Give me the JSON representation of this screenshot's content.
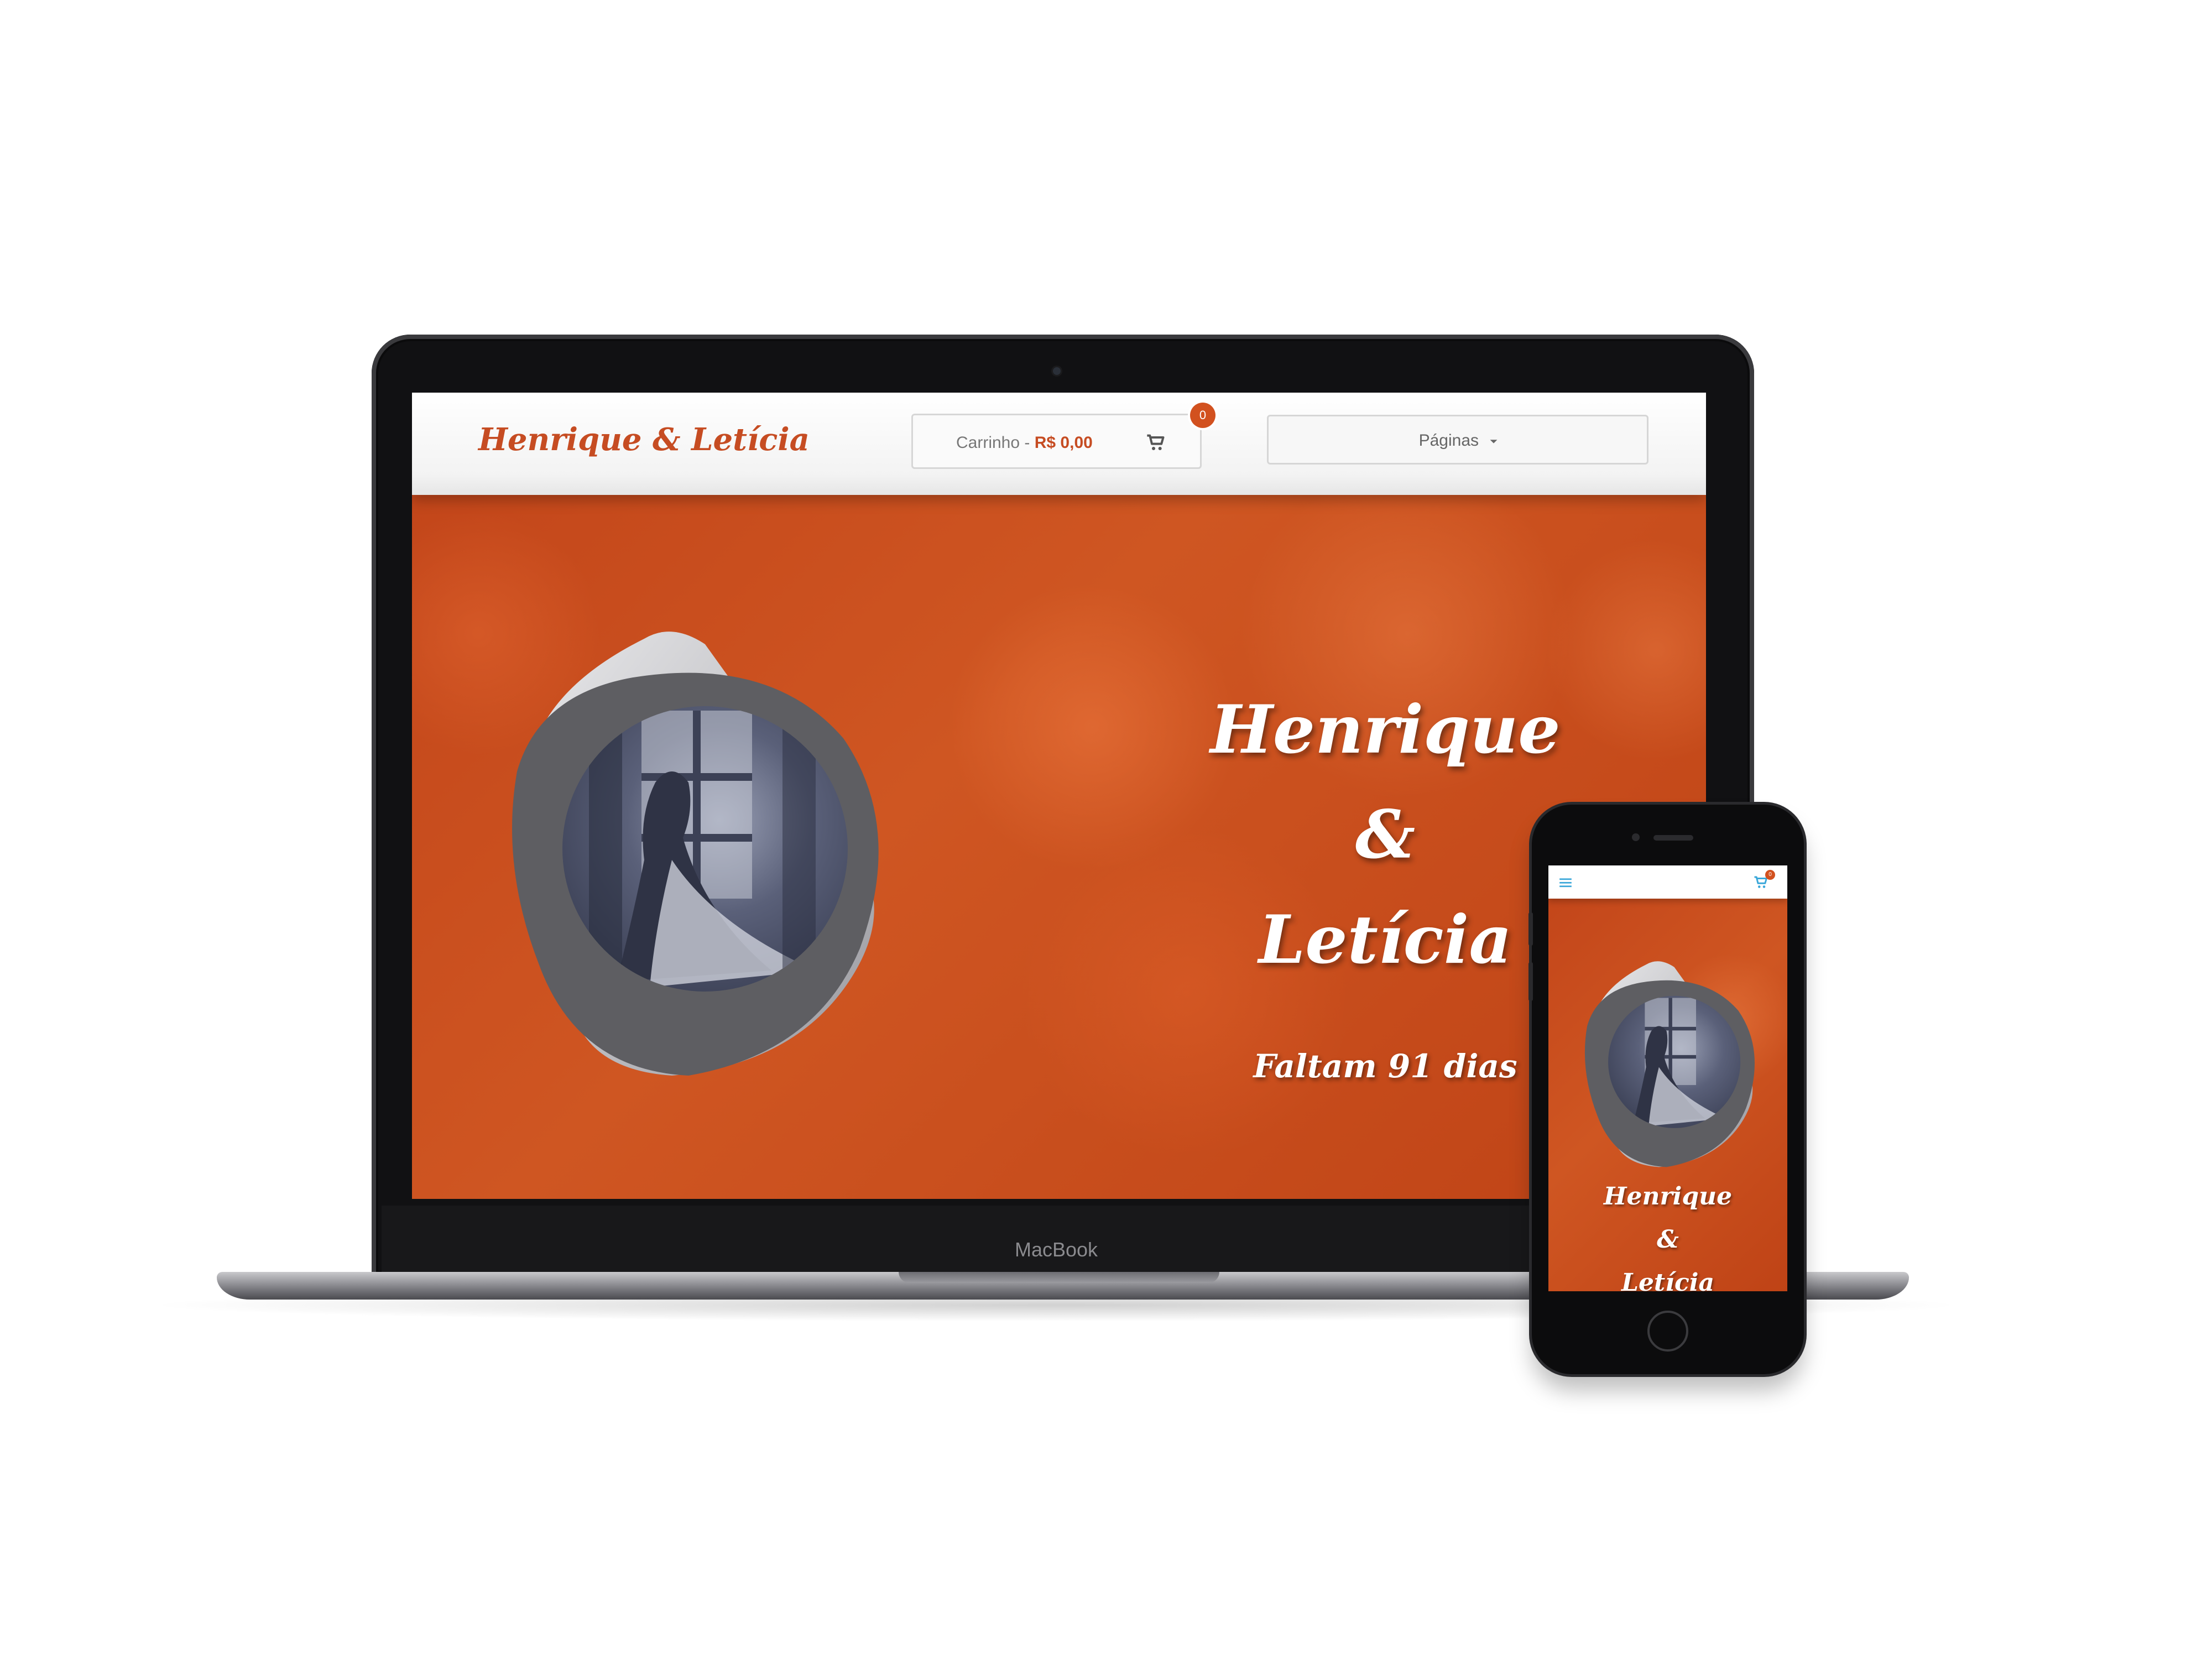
{
  "laptop": {
    "brand": "MacBook",
    "site": {
      "logo": "Henrique & Letícia",
      "cart": {
        "label": "Carrinho",
        "separator": " - ",
        "price": "R$ 0,00",
        "badge": "0",
        "icon": "cart-icon"
      },
      "pages_menu": {
        "label": "Páginas",
        "icon": "caret-down-icon"
      },
      "hero": {
        "name_first": "Henrique",
        "ampersand": "&",
        "name_second": "Letícia",
        "countdown": "Faltam 91 dias"
      }
    }
  },
  "phone": {
    "site": {
      "menu_icon": "hamburger-menu-icon",
      "cart_icon": "cart-icon",
      "cart_badge": "0",
      "hero": {
        "name_first": "Henrique",
        "ampersand": "&",
        "name_second": "Letícia"
      }
    }
  },
  "colors": {
    "accent": "#c64c22",
    "hero_background": "#c5481a",
    "icon_blue": "#3aa7d9"
  }
}
